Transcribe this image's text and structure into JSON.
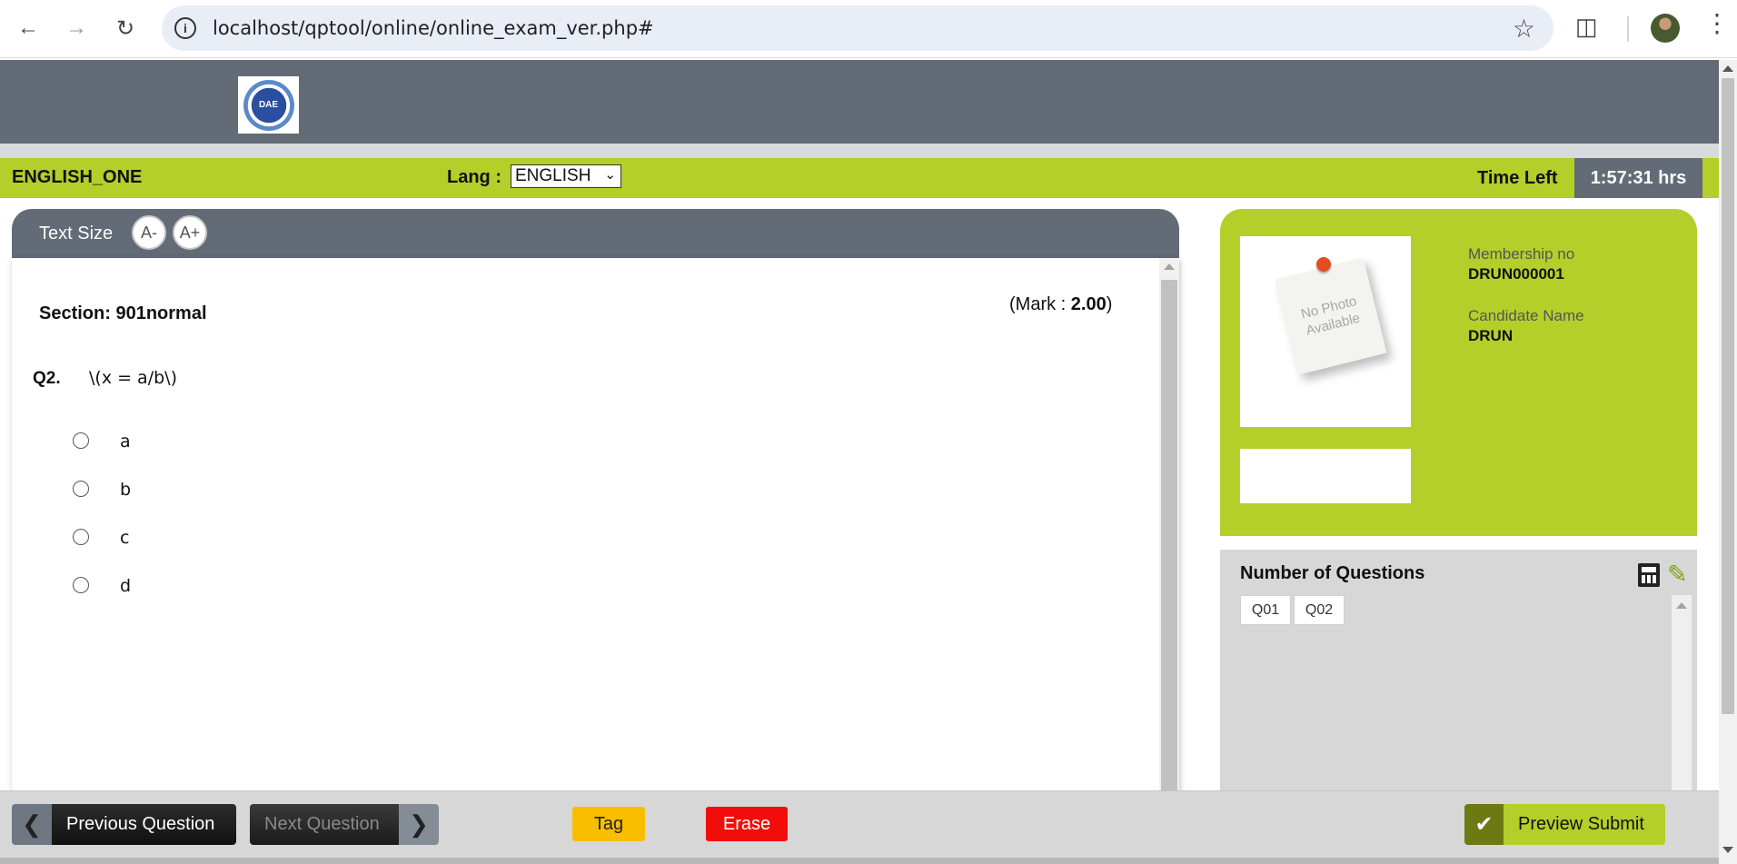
{
  "browser": {
    "url": "localhost/qptool/online/online_exam_ver.php#",
    "icons": [
      "back-icon",
      "forward-icon",
      "reload-icon",
      "info-icon",
      "star-icon",
      "extensions-icon",
      "profile-avatar",
      "menu-icon"
    ]
  },
  "header": {
    "logo_text": "DAE"
  },
  "exam_bar": {
    "exam_name": "ENGLISH_ONE",
    "lang_label": "Lang :",
    "lang_selected": "ENGLISH",
    "time_left_label": "Time Left",
    "time_left_value": "1:57:31 hrs"
  },
  "question_panel": {
    "text_size_label": "Text Size",
    "decrease_label": "A-",
    "increase_label": "A+",
    "section_title": "Section: 901normal",
    "mark_prefix": "(Mark : ",
    "mark_value": "2.00",
    "mark_suffix": ")",
    "question_number": "Q2.",
    "question_text": "\\(x = a/b\\)",
    "options": [
      "a",
      "b",
      "c",
      "d"
    ]
  },
  "candidate": {
    "photo_placeholder": "No Photo Available",
    "membership_label": "Membership no",
    "membership_value": "DRUN000001",
    "name_label": "Candidate Name",
    "name_value": "DRUN"
  },
  "question_nav": {
    "title": "Number of Questions",
    "questions": [
      "Q01",
      "Q02"
    ]
  },
  "footer": {
    "previous_label": "Previous Question",
    "next_label": "Next Question",
    "tag_label": "Tag",
    "erase_label": "Erase",
    "submit_label": "Preview Submit"
  },
  "colors": {
    "accent_green": "#b4cf2a",
    "header_gray": "#626b76",
    "tag_yellow": "#f9be00",
    "erase_red": "#f30c0c"
  }
}
